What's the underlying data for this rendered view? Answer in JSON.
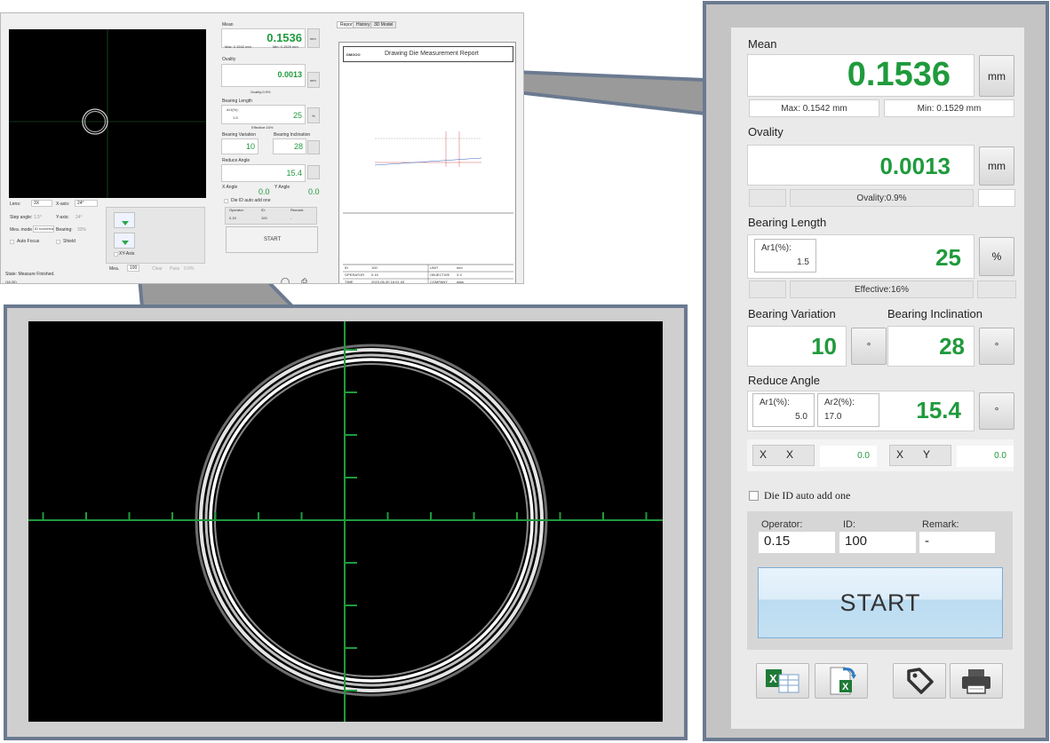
{
  "mini_app": {
    "tabs": [
      "Report",
      "History",
      "3D Model"
    ],
    "lens_label": "Lens:",
    "lens_value": "3X",
    "xaxis_label": "X-axis:",
    "xaxis_value": "24°",
    "step_label": "Step angle:",
    "step_value": "1.5°",
    "yaxis_label": "Y-axis:",
    "yaxis_value": "24°",
    "mode_label": "Mea. mode",
    "mode_value": "ID four/mtra",
    "bearing_label": "Bearing:",
    "bearing_value": "33%",
    "autofocus_label": "Auto Focus",
    "shield_label": "Shield",
    "xy_axis_label": "XY-Axis",
    "mea_label": "Mea.",
    "mea_value": "100",
    "clear_label": "Clear",
    "pass_label": "Pass",
    "pass_value": "0.0%",
    "state": "State: Measure Finished.",
    "coord": "(16,26)",
    "report_title": "Drawing Die Measurement Report",
    "report_logo": "DMGOO",
    "report_fields": {
      "id_label": "ID",
      "id_value": "100",
      "unit_label": "UNIT",
      "unit_value": "mm",
      "operator_label": "OPERATOR",
      "operator_value": "0.15",
      "objective_label": "OBJECTIVE",
      "objective_value": "3 X",
      "time_label": "TIME",
      "time_value": "2023-06-30 16:01:43",
      "company_label": "COMPANY",
      "company_value": "data"
    }
  },
  "viewer": {
    "crosshair_color": "#1f9a3c",
    "ring_color": "#ffffff"
  },
  "panel": {
    "mean": {
      "label": "Mean",
      "value": "0.1536",
      "unit": "mm",
      "max": "Max: 0.1542 mm",
      "min": "Min: 0.1529 mm"
    },
    "ovality": {
      "label": "Ovality",
      "value": "0.0013",
      "unit": "mm",
      "sub": "Ovality:0.9%"
    },
    "bearing_length": {
      "label": "Bearing Length",
      "ar1_label": "Ar1(%):",
      "ar1_value": "1.5",
      "value": "25",
      "unit": "%",
      "sub": "Effective:16%"
    },
    "bearing_variation": {
      "label": "Bearing Variation",
      "value": "10",
      "unit": "°"
    },
    "bearing_inclination": {
      "label": "Bearing Inclination",
      "value": "28",
      "unit": "°"
    },
    "reduce_angle": {
      "label": "Reduce Angle",
      "ar1_label": "Ar1(%):",
      "ar1_value": "5.0",
      "ar2_label": "Ar2(%):",
      "ar2_value": "17.0",
      "value": "15.4",
      "unit": "°"
    },
    "angles": {
      "x_label_a": "X",
      "x_label_b": "X",
      "x_value": "0.0",
      "y_label_a": "X",
      "y_label_b": "Y",
      "y_value": "0.0"
    },
    "die_id_auto": "Die ID auto add one",
    "operator_label": "Operator:",
    "operator_value": "0.15",
    "id_label": "ID:",
    "id_value": "100",
    "remark_label": "Remark:",
    "remark_value": "-",
    "start_label": "START",
    "icons": [
      "excel-export-icon",
      "excel-import-icon",
      "tag-icon",
      "printer-icon"
    ],
    "green": "#1f9a3c"
  }
}
